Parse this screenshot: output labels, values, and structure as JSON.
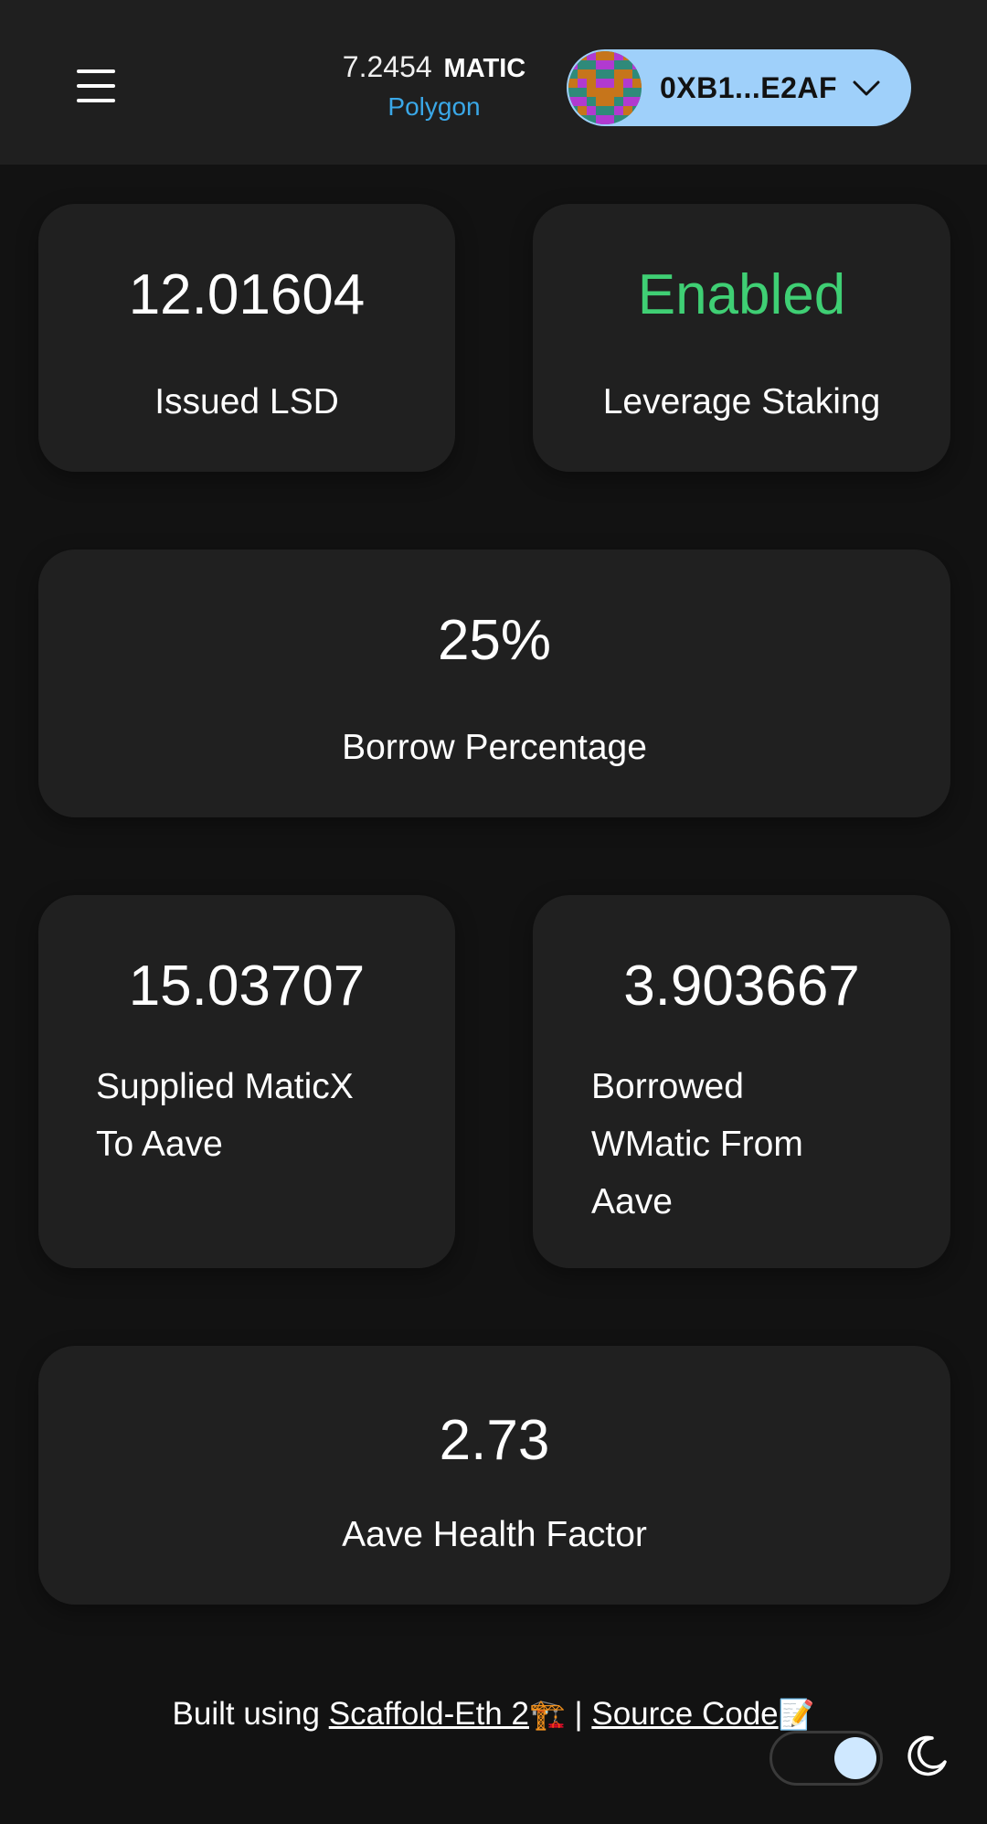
{
  "header": {
    "menu_icon": "hamburger-menu-icon",
    "balance": {
      "amount": "7.2454",
      "symbol": "MATIC"
    },
    "network": "Polygon",
    "wallet": {
      "address": "0XB1...E2AF",
      "avatar_icon": "blockie-avatar",
      "dropdown_icon": "chevron-down-icon"
    },
    "accent_color": "#3aa8e8",
    "wallet_button_color": "#9fd0fa"
  },
  "stats": {
    "issued_lsd": {
      "value": "12.01604",
      "label": "Issued LSD"
    },
    "leverage_staking": {
      "value": "Enabled",
      "label": "Leverage Staking",
      "value_color": "#3fcf74"
    },
    "borrow_percentage": {
      "value": "25%",
      "label": "Borrow Percentage"
    },
    "supplied_maticx": {
      "value": "15.03707",
      "label_line1": "Supplied MaticX",
      "label_line2": "To Aave"
    },
    "borrowed_wmatic": {
      "value": "3.903667",
      "label_line1": "Borrowed",
      "label_line2": "WMatic From",
      "label_line3": "Aave"
    },
    "health_factor": {
      "value": "2.73",
      "label": "Aave Health Factor"
    }
  },
  "footer": {
    "prefix": "Built using ",
    "scaffold_link": "Scaffold-Eth 2",
    "scaffold_emoji": "🏗️",
    "separator": " | ",
    "source_link": "Source Code",
    "source_emoji": "📝",
    "theme_toggle_icon": "theme-toggle",
    "moon_icon": "moon-icon"
  }
}
